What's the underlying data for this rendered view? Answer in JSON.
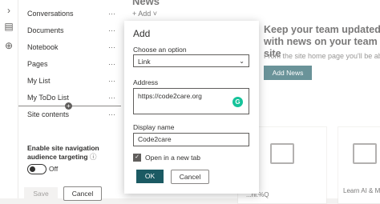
{
  "nav": {
    "items": [
      {
        "label": "Conversations",
        "more": "···"
      },
      {
        "label": "Documents",
        "more": "···"
      },
      {
        "label": "Notebook",
        "more": "···"
      },
      {
        "label": "Pages",
        "more": "···"
      },
      {
        "label": "My List",
        "more": "···"
      },
      {
        "label": "My ToDo List",
        "more": "···"
      },
      {
        "label": "Site contents",
        "more": "···"
      }
    ],
    "audience_label": "Enable site navigation audience targeting",
    "audience_info_icon": "ⓘ",
    "toggle_state": "Off",
    "save_label": "Save",
    "cancel_label": "Cancel"
  },
  "page": {
    "news_title": "News",
    "add_link": "+ Add ˅",
    "promo_title": "Keep your team updated with news on your team site",
    "promo_text": "From the site home page you'll be able to",
    "add_news_label": "Add News",
    "card_texts": [
      "...ni:%Q",
      "Learn AI & M"
    ]
  },
  "dialog": {
    "title": "Add",
    "choose_label": "Choose an option",
    "option_value": "Link",
    "address_label": "Address",
    "address_value": "https://code2care.org",
    "display_name_label": "Display name",
    "display_name_value": "Code2care",
    "new_tab_label": "Open in a new tab",
    "new_tab_checked": true,
    "ok_label": "OK",
    "cancel_label": "Cancel"
  },
  "colors": {
    "accent": "#1b5a63",
    "grammarly": "#15c39a"
  }
}
